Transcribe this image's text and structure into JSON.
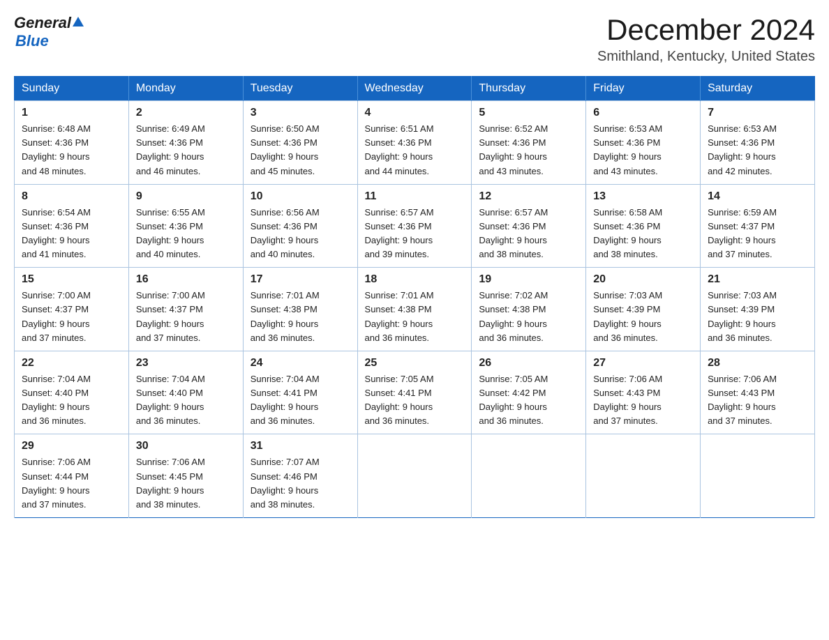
{
  "header": {
    "logo": {
      "general": "General",
      "triangle": "▲",
      "blue": "Blue"
    },
    "title": "December 2024",
    "location": "Smithland, Kentucky, United States"
  },
  "calendar": {
    "days_of_week": [
      "Sunday",
      "Monday",
      "Tuesday",
      "Wednesday",
      "Thursday",
      "Friday",
      "Saturday"
    ],
    "weeks": [
      [
        {
          "day": "1",
          "sunrise": "6:48 AM",
          "sunset": "4:36 PM",
          "daylight": "9 hours and 48 minutes."
        },
        {
          "day": "2",
          "sunrise": "6:49 AM",
          "sunset": "4:36 PM",
          "daylight": "9 hours and 46 minutes."
        },
        {
          "day": "3",
          "sunrise": "6:50 AM",
          "sunset": "4:36 PM",
          "daylight": "9 hours and 45 minutes."
        },
        {
          "day": "4",
          "sunrise": "6:51 AM",
          "sunset": "4:36 PM",
          "daylight": "9 hours and 44 minutes."
        },
        {
          "day": "5",
          "sunrise": "6:52 AM",
          "sunset": "4:36 PM",
          "daylight": "9 hours and 43 minutes."
        },
        {
          "day": "6",
          "sunrise": "6:53 AM",
          "sunset": "4:36 PM",
          "daylight": "9 hours and 43 minutes."
        },
        {
          "day": "7",
          "sunrise": "6:53 AM",
          "sunset": "4:36 PM",
          "daylight": "9 hours and 42 minutes."
        }
      ],
      [
        {
          "day": "8",
          "sunrise": "6:54 AM",
          "sunset": "4:36 PM",
          "daylight": "9 hours and 41 minutes."
        },
        {
          "day": "9",
          "sunrise": "6:55 AM",
          "sunset": "4:36 PM",
          "daylight": "9 hours and 40 minutes."
        },
        {
          "day": "10",
          "sunrise": "6:56 AM",
          "sunset": "4:36 PM",
          "daylight": "9 hours and 40 minutes."
        },
        {
          "day": "11",
          "sunrise": "6:57 AM",
          "sunset": "4:36 PM",
          "daylight": "9 hours and 39 minutes."
        },
        {
          "day": "12",
          "sunrise": "6:57 AM",
          "sunset": "4:36 PM",
          "daylight": "9 hours and 38 minutes."
        },
        {
          "day": "13",
          "sunrise": "6:58 AM",
          "sunset": "4:36 PM",
          "daylight": "9 hours and 38 minutes."
        },
        {
          "day": "14",
          "sunrise": "6:59 AM",
          "sunset": "4:37 PM",
          "daylight": "9 hours and 37 minutes."
        }
      ],
      [
        {
          "day": "15",
          "sunrise": "7:00 AM",
          "sunset": "4:37 PM",
          "daylight": "9 hours and 37 minutes."
        },
        {
          "day": "16",
          "sunrise": "7:00 AM",
          "sunset": "4:37 PM",
          "daylight": "9 hours and 37 minutes."
        },
        {
          "day": "17",
          "sunrise": "7:01 AM",
          "sunset": "4:38 PM",
          "daylight": "9 hours and 36 minutes."
        },
        {
          "day": "18",
          "sunrise": "7:01 AM",
          "sunset": "4:38 PM",
          "daylight": "9 hours and 36 minutes."
        },
        {
          "day": "19",
          "sunrise": "7:02 AM",
          "sunset": "4:38 PM",
          "daylight": "9 hours and 36 minutes."
        },
        {
          "day": "20",
          "sunrise": "7:03 AM",
          "sunset": "4:39 PM",
          "daylight": "9 hours and 36 minutes."
        },
        {
          "day": "21",
          "sunrise": "7:03 AM",
          "sunset": "4:39 PM",
          "daylight": "9 hours and 36 minutes."
        }
      ],
      [
        {
          "day": "22",
          "sunrise": "7:04 AM",
          "sunset": "4:40 PM",
          "daylight": "9 hours and 36 minutes."
        },
        {
          "day": "23",
          "sunrise": "7:04 AM",
          "sunset": "4:40 PM",
          "daylight": "9 hours and 36 minutes."
        },
        {
          "day": "24",
          "sunrise": "7:04 AM",
          "sunset": "4:41 PM",
          "daylight": "9 hours and 36 minutes."
        },
        {
          "day": "25",
          "sunrise": "7:05 AM",
          "sunset": "4:41 PM",
          "daylight": "9 hours and 36 minutes."
        },
        {
          "day": "26",
          "sunrise": "7:05 AM",
          "sunset": "4:42 PM",
          "daylight": "9 hours and 36 minutes."
        },
        {
          "day": "27",
          "sunrise": "7:06 AM",
          "sunset": "4:43 PM",
          "daylight": "9 hours and 37 minutes."
        },
        {
          "day": "28",
          "sunrise": "7:06 AM",
          "sunset": "4:43 PM",
          "daylight": "9 hours and 37 minutes."
        }
      ],
      [
        {
          "day": "29",
          "sunrise": "7:06 AM",
          "sunset": "4:44 PM",
          "daylight": "9 hours and 37 minutes."
        },
        {
          "day": "30",
          "sunrise": "7:06 AM",
          "sunset": "4:45 PM",
          "daylight": "9 hours and 38 minutes."
        },
        {
          "day": "31",
          "sunrise": "7:07 AM",
          "sunset": "4:46 PM",
          "daylight": "9 hours and 38 minutes."
        },
        null,
        null,
        null,
        null
      ]
    ]
  }
}
